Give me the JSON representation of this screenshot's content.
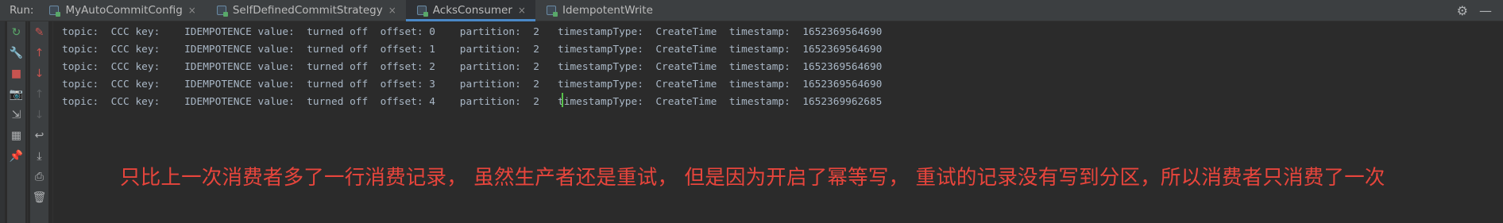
{
  "run_label": "Run:",
  "tabs": [
    {
      "label": "MyAutoCommitConfig",
      "active": false,
      "closable": true
    },
    {
      "label": "SelfDefinedCommitStrategy",
      "active": false,
      "closable": true
    },
    {
      "label": "AcksConsumer",
      "active": true,
      "closable": true
    },
    {
      "label": "IdempotentWrite",
      "active": false,
      "closable": false
    }
  ],
  "close_glyph": "×",
  "toolbar_right": {
    "settings_icon": "gear-icon",
    "hide_icon": "minimize-icon",
    "settings_glyph": "⚙",
    "hide_glyph": "—"
  },
  "tool_col1": [
    {
      "name": "rerun-icon",
      "glyph": "↻",
      "color": "#59a869"
    },
    {
      "name": "wrench-icon",
      "glyph": "🔧",
      "color": "#afb1b3"
    },
    {
      "name": "stop-icon",
      "glyph": "■",
      "color": "#c75450"
    },
    {
      "name": "camera-icon",
      "glyph": "📷",
      "color": "#afb1b3"
    },
    {
      "name": "login-icon",
      "glyph": "⇲",
      "color": "#afb1b3"
    },
    {
      "name": "layout-icon",
      "glyph": "▦",
      "color": "#afb1b3"
    },
    {
      "name": "pin-icon",
      "glyph": "📌",
      "color": "#afb1b3"
    }
  ],
  "tool_col2": [
    {
      "name": "clear-icon",
      "glyph": "✎",
      "color": "#c75450"
    },
    {
      "name": "up-arrow-icon",
      "glyph": "↑",
      "color": "#c75450"
    },
    {
      "name": "down-arrow-icon",
      "glyph": "↓",
      "color": "#c75450"
    },
    {
      "name": "up-disabled-icon",
      "glyph": "↑",
      "color": "#5a5d5f"
    },
    {
      "name": "down-disabled-icon",
      "glyph": "↓",
      "color": "#5a5d5f"
    },
    {
      "name": "soft-wrap-icon",
      "glyph": "↩",
      "color": "#afb1b3"
    },
    {
      "name": "scroll-to-end-icon",
      "glyph": "⤓",
      "color": "#afb1b3"
    },
    {
      "name": "print-icon",
      "glyph": "⎙",
      "color": "#afb1b3"
    },
    {
      "name": "trash-icon",
      "glyph": "🗑",
      "color": "#afb1b3"
    }
  ],
  "console_lines": [
    "topic:  CCC key:    IDEMPOTENCE value:  turned off  offset: 0    partition:  2   timestampType:  CreateTime  timestamp:  1652369564690",
    "topic:  CCC key:    IDEMPOTENCE value:  turned off  offset: 1    partition:  2   timestampType:  CreateTime  timestamp:  1652369564690",
    "topic:  CCC key:    IDEMPOTENCE value:  turned off  offset: 2    partition:  2   timestampType:  CreateTime  timestamp:  1652369564690",
    "topic:  CCC key:    IDEMPOTENCE value:  turned off  offset: 3    partition:  2   timestampType:  CreateTime  timestamp:  1652369564690",
    "topic:  CCC key:    IDEMPOTENCE value:  turned off  offset: 4    partition:  2   timestampType:  CreateTime  timestamp:  1652369962685"
  ],
  "annotation": "只比上一次消费者多了一行消费记录， 虽然生产者还是重试， 但是因为开启了幂等写， 重试的记录没有写到分区，所以消费者只消费了一次",
  "colors": {
    "accent": "#4a88c7",
    "annotation": "#e8453c",
    "console_text": "#a9b7c6",
    "caret": "#57c24a"
  }
}
